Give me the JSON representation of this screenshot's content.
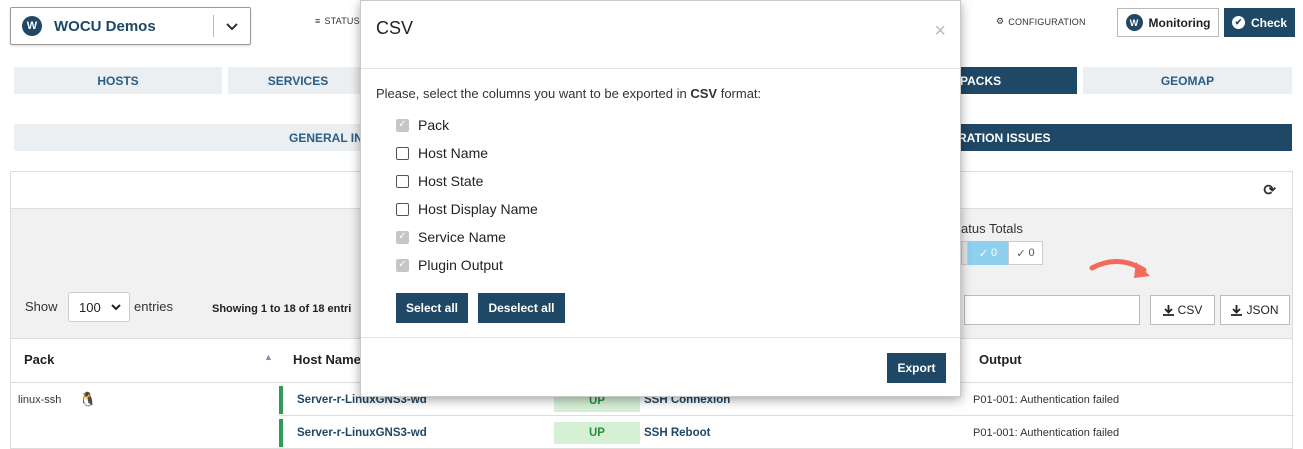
{
  "header": {
    "site": "WOCU Demos",
    "site_logo": "W",
    "nav_status": "STATUS",
    "nav_configuration": "CONFIGURATION",
    "monitoring_label": "Monitoring",
    "check_label": "Check"
  },
  "tabs_row1": [
    "HOSTS",
    "SERVICES",
    "PACKS",
    "GEOMAP"
  ],
  "tabs_row2": [
    "GENERAL IN",
    "RATION ISSUES"
  ],
  "table_tools": {
    "show_label": "Show",
    "page_size": "100",
    "entries_label": "entries",
    "showing_text": "Showing 1 to 18 of 18 entri",
    "status_totals_label": "atus Totals",
    "total_checked": "0",
    "total_other": "0",
    "csv_label": "CSV",
    "json_label": "JSON"
  },
  "table": {
    "headers": {
      "pack": "Pack",
      "host_name": "Host Name",
      "output": "Output"
    },
    "rows": [
      {
        "pack": "linux-ssh",
        "host": "Server-r-LinuxGNS3-wd",
        "state": "UP",
        "service": "SSH Connexion",
        "output": "P01-001: Authentication failed"
      },
      {
        "pack": "",
        "host": "Server-r-LinuxGNS3-wd",
        "state": "UP",
        "service": "SSH Reboot",
        "output": "P01-001: Authentication failed"
      }
    ]
  },
  "modal": {
    "title": "CSV",
    "close": "×",
    "instruction_pre": "Please, select the columns you want to be exported in ",
    "instruction_bold": "CSV",
    "instruction_post": " format:",
    "options": [
      {
        "label": "Pack",
        "checked": true,
        "disabled": true
      },
      {
        "label": "Host Name",
        "checked": false,
        "disabled": false
      },
      {
        "label": "Host State",
        "checked": false,
        "disabled": false
      },
      {
        "label": "Host Display Name",
        "checked": false,
        "disabled": false
      },
      {
        "label": "Service Name",
        "checked": true,
        "disabled": true
      },
      {
        "label": "Plugin Output",
        "checked": true,
        "disabled": true
      }
    ],
    "select_all": "Select all",
    "deselect_all": "Deselect all",
    "export": "Export"
  },
  "colors": {
    "primary": "#1f4766",
    "tab_bg": "#eceff1",
    "up_bg": "#d6f0d6",
    "up_text": "#2c8f3c",
    "arrow": "#f26a5b",
    "total_checked_bg": "#8fd0ee"
  },
  "icons": [
    "wocu-logo-icon",
    "chevron-down-icon",
    "menu-icon",
    "gear-icon",
    "check-circle-icon",
    "refresh-icon",
    "download-icon",
    "sort-asc-icon",
    "linux-icon",
    "close-icon",
    "arrow-icon"
  ]
}
